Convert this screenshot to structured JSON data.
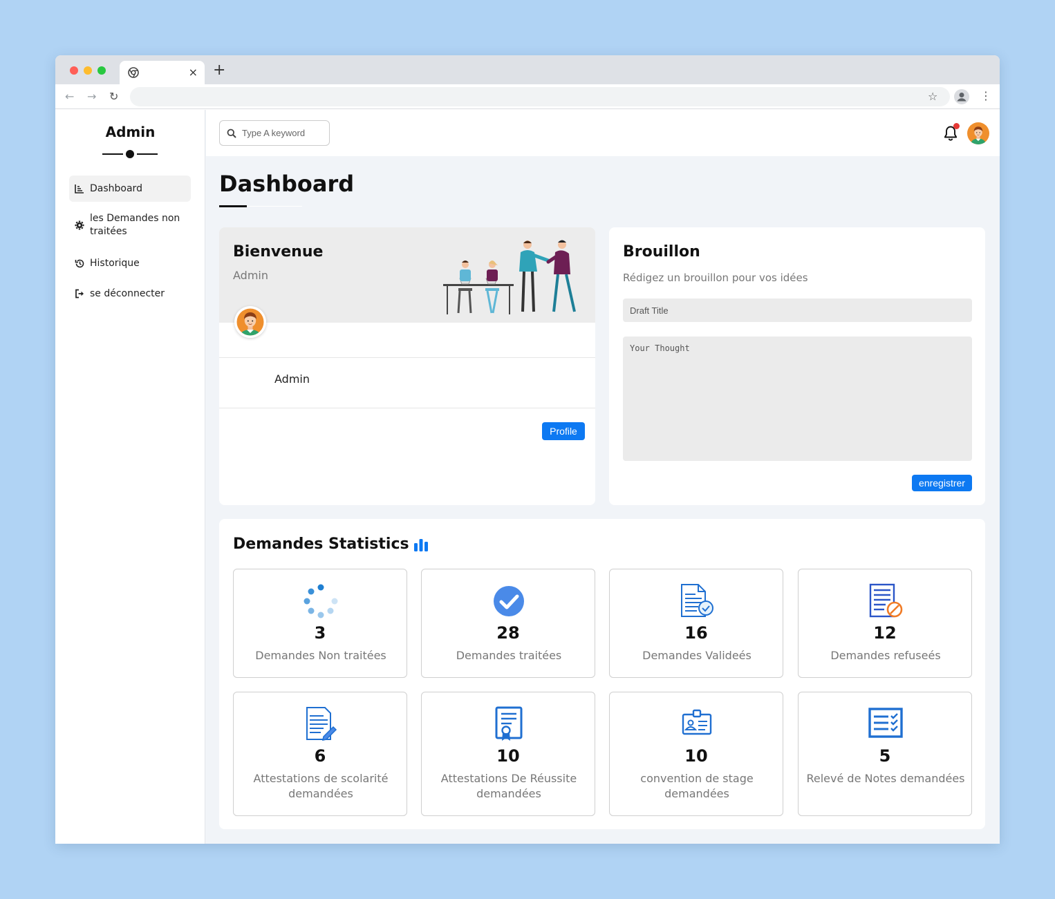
{
  "browser": {
    "tab_close": "×",
    "new_tab": "+",
    "back": "←",
    "forward": "→",
    "reload": "↻",
    "bookmark": "☆",
    "menu": "⋮"
  },
  "sidebar": {
    "brand": "Admin",
    "items": [
      {
        "label": "Dashboard",
        "icon": "chart-icon"
      },
      {
        "label": "les Demandes non traitées",
        "icon": "gear-icon"
      },
      {
        "label": "Historique",
        "icon": "history-icon"
      },
      {
        "label": "se déconnecter",
        "icon": "logout-icon"
      }
    ]
  },
  "topbar": {
    "search_placeholder": "Type A keyword"
  },
  "main": {
    "title": "Dashboard"
  },
  "welcome": {
    "title": "Bienvenue",
    "subtitle": "Admin",
    "name": "Admin",
    "profile_button": "Profile"
  },
  "draft": {
    "title": "Brouillon",
    "subtitle": "Rédigez un brouillon pour vos idées",
    "title_placeholder": "Draft Title",
    "body_placeholder": "Your Thought",
    "save_button": "enregistrer"
  },
  "stats": {
    "title": "Demandes Statistics",
    "cards": [
      {
        "value": "3",
        "label": "Demandes Non traitées",
        "icon": "spinner-icon"
      },
      {
        "value": "28",
        "label": "Demandes traitées",
        "icon": "check-circle-icon"
      },
      {
        "value": "16",
        "label": "Demandes Valideés",
        "icon": "document-check-icon"
      },
      {
        "value": "12",
        "label": "Demandes refuseés",
        "icon": "document-rejected-icon"
      },
      {
        "value": "6",
        "label": "Attestations de scolarité demandées",
        "icon": "document-edit-icon"
      },
      {
        "value": "10",
        "label": "Attestations De Réussite demandées",
        "icon": "certificate-icon"
      },
      {
        "value": "10",
        "label": "convention de stage demandées",
        "icon": "id-badge-icon"
      },
      {
        "value": "5",
        "label": "Relevé de Notes demandées",
        "icon": "checklist-icon"
      }
    ]
  },
  "colors": {
    "accent": "#0d79f2",
    "background": "#b0d3f4",
    "notification": "#e53935"
  }
}
